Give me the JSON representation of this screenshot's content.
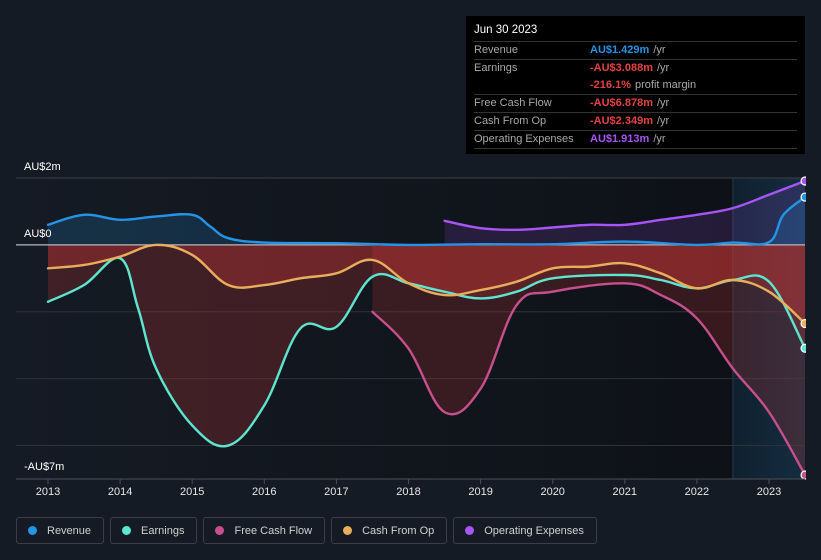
{
  "tooltip": {
    "date": "Jun 30 2023",
    "rows": [
      {
        "label": "Revenue",
        "value": "AU$1.429m",
        "suffix": "/yr",
        "color": "#2394e6"
      },
      {
        "label": "Earnings",
        "value": "-AU$3.088m",
        "suffix": "/yr",
        "color": "#e64141"
      },
      {
        "label": "",
        "value": "-216.1%",
        "suffix": "profit margin",
        "color": "#e64141"
      },
      {
        "label": "Free Cash Flow",
        "value": "-AU$6.878m",
        "suffix": "/yr",
        "color": "#e64141"
      },
      {
        "label": "Cash From Op",
        "value": "-AU$2.349m",
        "suffix": "/yr",
        "color": "#e64141"
      },
      {
        "label": "Operating Expenses",
        "value": "AU$1.913m",
        "suffix": "/yr",
        "color": "#a855f7"
      }
    ]
  },
  "legend": [
    {
      "label": "Revenue",
      "color": "#2394e6"
    },
    {
      "label": "Earnings",
      "color": "#5ee5d0"
    },
    {
      "label": "Free Cash Flow",
      "color": "#c94f8c"
    },
    {
      "label": "Cash From Op",
      "color": "#e8ae5c"
    },
    {
      "label": "Operating Expenses",
      "color": "#a855f7"
    }
  ],
  "chart_data": {
    "type": "line",
    "title": "",
    "xlabel": "",
    "ylabel": "",
    "y_unit": "AU$m",
    "ylim": [
      -7,
      2
    ],
    "xlim": [
      2012.55,
      2023.5
    ],
    "y_tick_labels": [
      {
        "value": 2,
        "label": "AU$2m"
      },
      {
        "value": 0,
        "label": "AU$0"
      },
      {
        "value": -7,
        "label": "-AU$7m"
      }
    ],
    "x_tick_labels": [
      "2013",
      "2014",
      "2015",
      "2016",
      "2017",
      "2018",
      "2019",
      "2020",
      "2021",
      "2022",
      "2023"
    ],
    "x_ticks": [
      2013,
      2014,
      2015,
      2016,
      2017,
      2018,
      2019,
      2020,
      2021,
      2022,
      2023
    ],
    "grid": true,
    "grid_values": [
      2,
      -2,
      -4,
      -6
    ],
    "forecast_region_start": 2022.5,
    "series": [
      {
        "name": "Revenue",
        "color": "#2394e6",
        "x": [
          2013,
          2013.5,
          2014,
          2014.5,
          2015,
          2015.25,
          2015.5,
          2016,
          2017,
          2018,
          2019,
          2020,
          2021,
          2022,
          2022.5,
          2023,
          2023.2,
          2023.5
        ],
        "values": [
          0.6,
          0.9,
          0.75,
          0.85,
          0.9,
          0.55,
          0.2,
          0.07,
          0.05,
          0.0,
          0.02,
          0.02,
          0.1,
          0.0,
          0.07,
          0.08,
          0.9,
          1.43
        ]
      },
      {
        "name": "Earnings",
        "color": "#5ee5d0",
        "x": [
          2013,
          2013.5,
          2014,
          2014.25,
          2014.5,
          2015,
          2015.5,
          2016,
          2016.5,
          2017,
          2017.5,
          2018,
          2018.5,
          2019,
          2019.5,
          2020,
          2021,
          2021.5,
          2022,
          2022.5,
          2023,
          2023.5
        ],
        "values": [
          -1.7,
          -1.2,
          -0.4,
          -1.9,
          -3.7,
          -5.4,
          -6.0,
          -4.8,
          -2.5,
          -2.45,
          -0.95,
          -1.15,
          -1.4,
          -1.6,
          -1.4,
          -1.0,
          -0.9,
          -1.05,
          -1.3,
          -1.05,
          -1.1,
          -3.09
        ]
      },
      {
        "name": "Free Cash Flow",
        "color": "#c94f8c",
        "x": [
          2017.5,
          2018,
          2018.5,
          2019,
          2019.5,
          2020,
          2021,
          2021.5,
          2022,
          2022.5,
          2023,
          2023.5
        ],
        "values": [
          -2.0,
          -3.1,
          -5.0,
          -4.3,
          -1.8,
          -1.4,
          -1.15,
          -1.5,
          -2.2,
          -3.7,
          -5.0,
          -6.88
        ]
      },
      {
        "name": "Cash From Op",
        "color": "#e8ae5c",
        "x": [
          2013,
          2013.5,
          2014,
          2014.5,
          2015,
          2015.5,
          2016,
          2016.5,
          2017,
          2017.5,
          2018,
          2018.5,
          2019,
          2019.5,
          2020,
          2020.5,
          2021,
          2021.5,
          2022,
          2022.5,
          2023,
          2023.5
        ],
        "values": [
          -0.7,
          -0.6,
          -0.35,
          0.0,
          -0.3,
          -1.2,
          -1.2,
          -1.0,
          -0.85,
          -0.45,
          -1.15,
          -1.5,
          -1.35,
          -1.1,
          -0.7,
          -0.65,
          -0.55,
          -0.85,
          -1.3,
          -1.05,
          -1.4,
          -2.35
        ]
      },
      {
        "name": "Operating Expenses",
        "color": "#a855f7",
        "x": [
          2018.5,
          2019,
          2019.5,
          2020,
          2020.5,
          2021,
          2021.5,
          2022,
          2022.5,
          2023,
          2023.5
        ],
        "values": [
          0.72,
          0.5,
          0.45,
          0.52,
          0.6,
          0.6,
          0.75,
          0.9,
          1.1,
          1.5,
          1.91
        ]
      }
    ]
  }
}
